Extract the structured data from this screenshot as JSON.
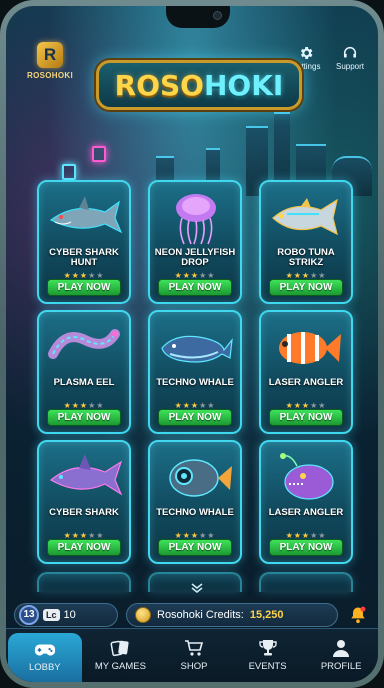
{
  "app": {
    "brand_short": "R",
    "brand_name": "ROSOHOKI",
    "title_part1": "ROSO",
    "title_part2": "HOKI"
  },
  "top_actions": [
    {
      "label": "Settings",
      "icon": "gear-icon"
    },
    {
      "label": "Support",
      "icon": "headset-icon"
    }
  ],
  "games": [
    {
      "name": "CYBER SHARK HUNT",
      "stars": 3,
      "max_stars": 5,
      "button": "PLAY NOW",
      "art": "shark"
    },
    {
      "name": "NEON JELLYFISH DROP",
      "stars": 3,
      "max_stars": 5,
      "button": "PLAY NOW",
      "art": "jellyfish"
    },
    {
      "name": "ROBO TUNA STRIKZ",
      "stars": 3,
      "max_stars": 5,
      "button": "PLAY NOW",
      "art": "tuna"
    },
    {
      "name": "PLASMA EEL",
      "stars": 3,
      "max_stars": 5,
      "button": "PLAY NOW",
      "art": "eel"
    },
    {
      "name": "TECHNO WHALE",
      "stars": 3,
      "max_stars": 5,
      "button": "PLAY NOW",
      "art": "whale"
    },
    {
      "name": "LASER ANGLER",
      "stars": 3,
      "max_stars": 5,
      "button": "PLAY NOW",
      "art": "clownfish"
    },
    {
      "name": "CYBER SHARK",
      "stars": 3,
      "max_stars": 5,
      "button": "PLAY NOW",
      "art": "shark2"
    },
    {
      "name": "TECHNO WHALE",
      "stars": 3,
      "max_stars": 5,
      "button": "PLAY NOW",
      "art": "robofish"
    },
    {
      "name": "LASER ANGLER",
      "stars": 3,
      "max_stars": 5,
      "button": "PLAY NOW",
      "art": "angler"
    }
  ],
  "status": {
    "level": "13",
    "lv_label": "Lc",
    "lv_value": "10",
    "credits_label": "Rosohoki Credits:",
    "credits_value": "15,250"
  },
  "nav": [
    {
      "label": "LOBBY",
      "icon": "gamepad-icon",
      "active": true
    },
    {
      "label": "MY GAMES",
      "icon": "cards-icon",
      "active": false
    },
    {
      "label": "SHOP",
      "icon": "cart-icon",
      "active": false
    },
    {
      "label": "EVENTS",
      "icon": "trophy-icon",
      "active": false
    },
    {
      "label": "PROFILE",
      "icon": "user-icon",
      "active": false
    }
  ],
  "colors": {
    "accent_cyan": "#3fd8ee",
    "button_green": "#2bc547",
    "gold": "#ffd54a",
    "nav_active": "#2aa8d6"
  }
}
